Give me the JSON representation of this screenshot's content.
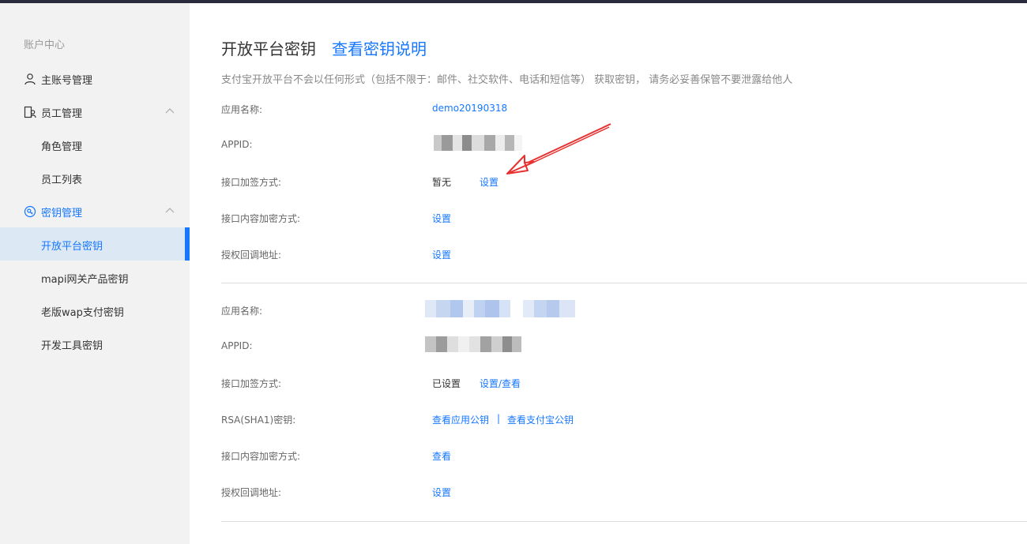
{
  "sidebar": {
    "title": "账户中心",
    "items": [
      {
        "label": "主账号管理",
        "icon": "user-icon"
      },
      {
        "label": "员工管理",
        "icon": "staff-icon"
      },
      {
        "label": "角色管理"
      },
      {
        "label": "员工列表"
      },
      {
        "label": "密钥管理",
        "icon": "key-icon"
      },
      {
        "label": "开放平台密钥"
      },
      {
        "label": "mapi网关产品密钥"
      },
      {
        "label": "老版wap支付密钥"
      },
      {
        "label": "开发工具密钥"
      }
    ]
  },
  "main": {
    "title": "开放平台密钥",
    "title_link": "查看密钥说明",
    "description": "支付宝开放平台不会以任何形式（包括不限于：邮件、社交软件、电话和短信等） 获取密钥， 请务必妥善保管不要泄露给他人",
    "app1": {
      "name_label": "应用名称:",
      "name_value": "demo20190318",
      "appid_label": "APPID:",
      "sign_label": "接口加签方式:",
      "sign_status": "暂无",
      "sign_action": "设置",
      "encrypt_label": "接口内容加密方式:",
      "encrypt_action": "设置",
      "callback_label": "授权回调地址:",
      "callback_action": "设置"
    },
    "app2": {
      "name_label": "应用名称:",
      "appid_label": "APPID:",
      "sign_label": "接口加签方式:",
      "sign_status": "已设置",
      "sign_action": "设置/查看",
      "rsa_label": "RSA(SHA1)密钥:",
      "rsa_app_key": "查看应用公钥",
      "rsa_sep": "|",
      "rsa_alipay_key": "查看支付宝公钥",
      "encrypt_label": "接口内容加密方式:",
      "encrypt_action": "查看",
      "callback_label": "授权回调地址:",
      "callback_action": "设置"
    }
  },
  "colors": {
    "accent": "#1677ff",
    "active_bg": "#dce8f4",
    "annotation": "#e8302f"
  }
}
